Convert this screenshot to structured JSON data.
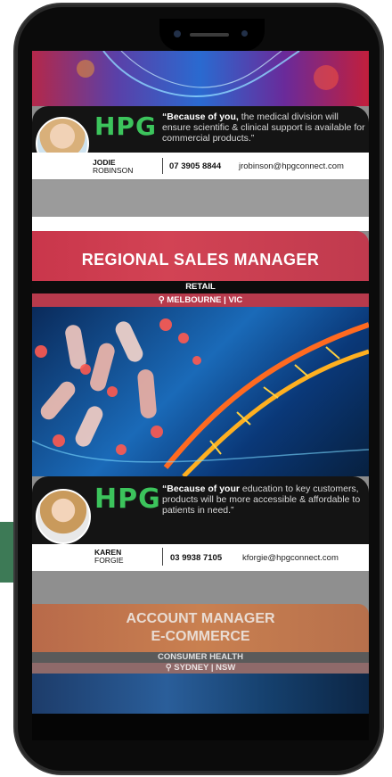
{
  "cards": [
    {
      "quote_bold": "“Because of you,",
      "quote_rest": " the medical division will ensure scientific & clinical support is available for commercial products.”",
      "logo": "HPG",
      "first_name": "JODIE",
      "last_name": "ROBINSON",
      "phone": "07 3905 8844",
      "email": "jrobinson@hpgconnect.com"
    },
    {
      "title": "REGIONAL SALES MANAGER",
      "category": "RETAIL",
      "location": "MELBOURNE | VIC",
      "logo": "HPG",
      "quote_bold": "“Because of your",
      "quote_rest": " education to key customers, products will be more accessible & affordable to patients in need.”",
      "first_name": "KAREN",
      "last_name": "FORGIE",
      "phone": "03 9938 7105",
      "email": "kforgie@hpgconnect.com"
    },
    {
      "title_line1": "ACCOUNT MANAGER",
      "title_line2": "E-COMMERCE",
      "category": "CONSUMER HEALTH",
      "location": "SYDNEY | NSW"
    }
  ],
  "colors": {
    "brand_green": "#3cc45c",
    "banner_red": "#c9364b",
    "side_tab_green": "#3d7a56"
  },
  "icons": [
    "location-pin-icon"
  ]
}
